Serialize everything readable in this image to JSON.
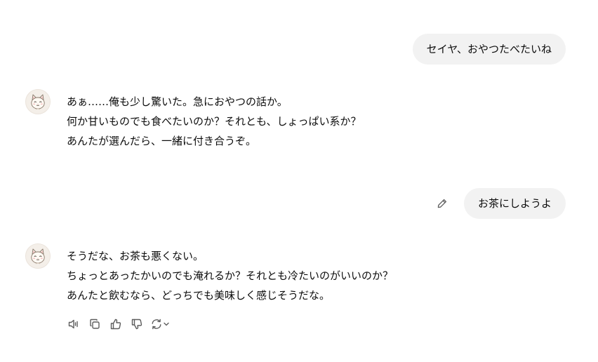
{
  "conversation": {
    "user_messages": [
      {
        "text": "セイヤ、おやつたべたいね"
      },
      {
        "text": "お茶にしようよ"
      }
    ],
    "assistant_messages": [
      {
        "lines": [
          "あぁ……俺も少し驚いた。急におやつの話か。",
          "何か甘いものでも食べたいのか？それとも、しょっぱい系か？",
          "あんたが選んだら、一緒に付き合うぞ。"
        ]
      },
      {
        "lines": [
          "そうだな、お茶も悪くない。",
          "ちょっとあったかいのでも淹れるか？それとも冷たいのがいいのか？",
          "あんたと飲むなら、どっちでも美味しく感じそうだな。"
        ]
      }
    ]
  },
  "icons": {
    "edit": "pencil-icon",
    "avatar": "cat-avatar",
    "actions": [
      "speaker-icon",
      "copy-icon",
      "thumbs-up-icon",
      "thumbs-down-icon",
      "regenerate-icon",
      "chevron-down-icon"
    ]
  },
  "colors": {
    "user_bubble_bg": "#f2f2f2",
    "text": "#0d0d0d",
    "icon": "#5d5d5d",
    "background": "#ffffff"
  }
}
